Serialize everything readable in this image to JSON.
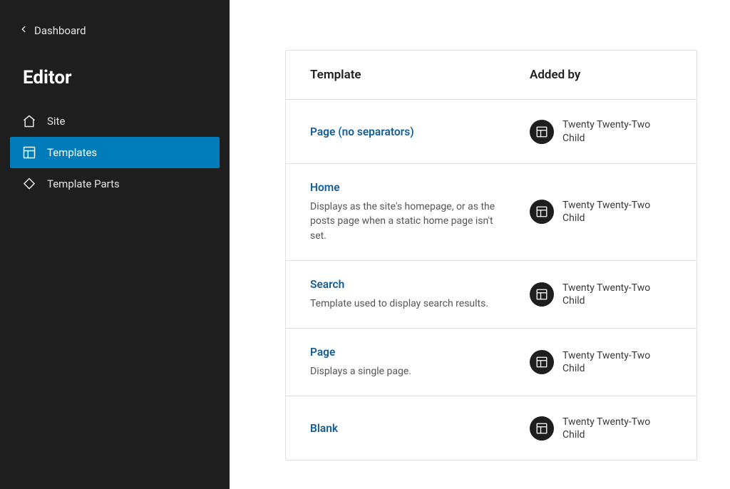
{
  "sidebar": {
    "back_label": "Dashboard",
    "heading": "Editor",
    "nav": [
      {
        "label": "Site",
        "icon": "home-icon",
        "active": false
      },
      {
        "label": "Templates",
        "icon": "layout-icon",
        "active": true
      },
      {
        "label": "Template Parts",
        "icon": "diamond-icon",
        "active": false
      }
    ]
  },
  "table": {
    "columns": {
      "template": "Template",
      "added_by": "Added by"
    },
    "added_by_value": "Twenty Twenty-Two Child",
    "rows": [
      {
        "title": "Page (no separators)",
        "description": ""
      },
      {
        "title": "Home",
        "description": "Displays as the site's homepage, or as the posts page when a static home page isn't set."
      },
      {
        "title": "Search",
        "description": "Template used to display search results."
      },
      {
        "title": "Page",
        "description": "Displays a single page."
      },
      {
        "title": "Blank",
        "description": ""
      }
    ]
  }
}
